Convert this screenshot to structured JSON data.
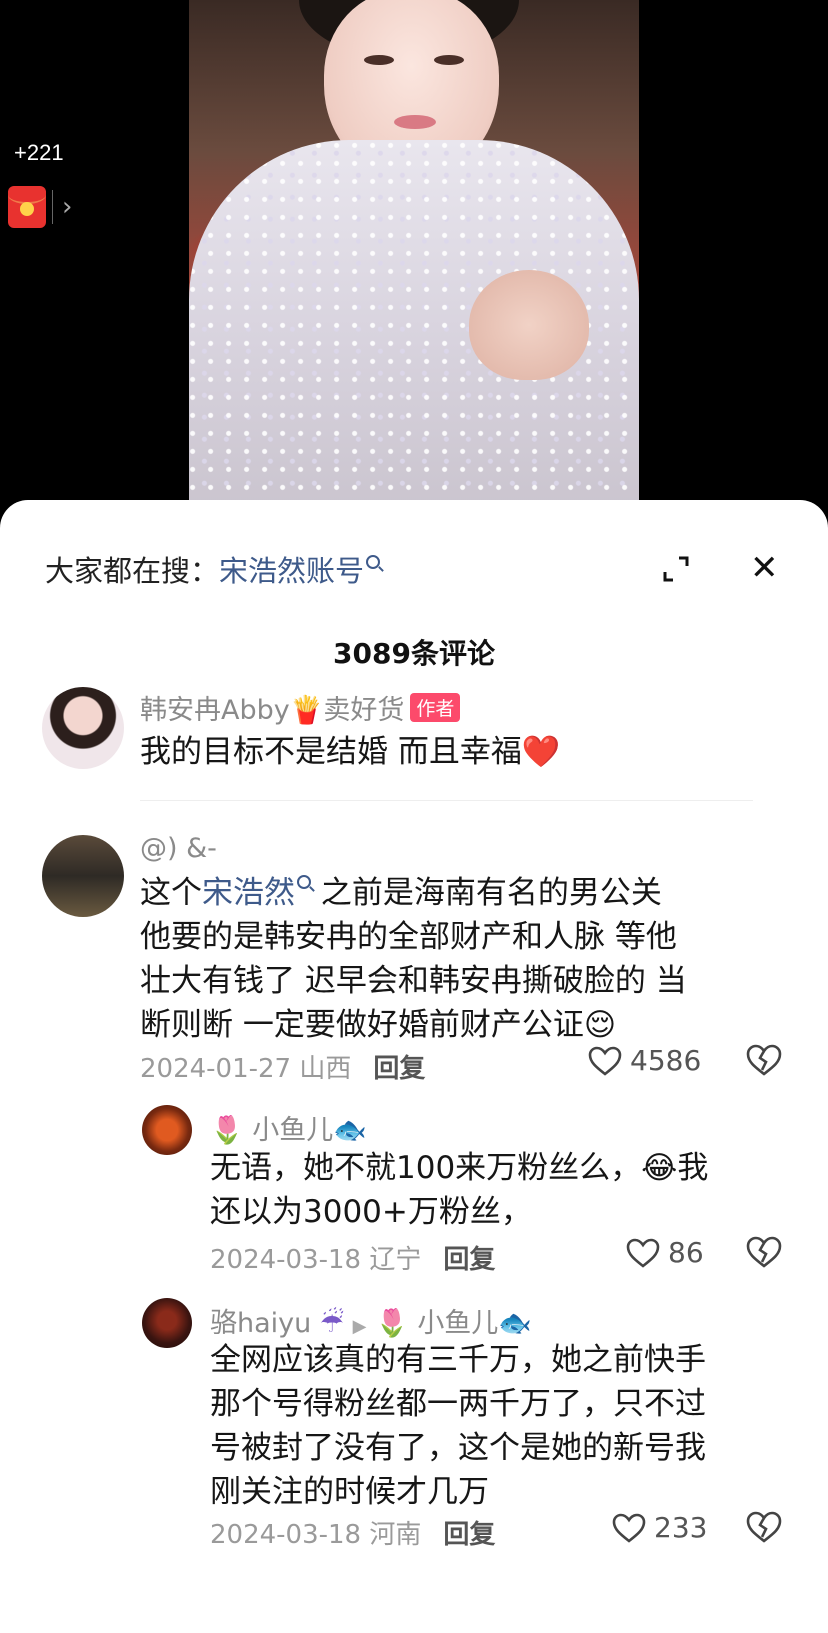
{
  "top": {
    "reward_count": "+221",
    "chevron": "›"
  },
  "sheet": {
    "search_label": "大家都在搜：",
    "search_term": "宋浩然账号",
    "close": "✕",
    "comment_count": "3089条评论"
  },
  "comments": [
    {
      "user": "韩安冉Abby",
      "user_suffix": "卖好货",
      "badge": "作者",
      "text": "我的目标不是结婚 而且幸福",
      "emoji": "❤️"
    },
    {
      "user": "@) &-",
      "text_prefix": "这个",
      "text_link": "宋浩然",
      "text_lines": [
        "之前是海南有名的男公关",
        "他要的是韩安冉的全部财产和人脉 等他",
        "壮大有钱了 迟早会和韩安冉撕破脸的 当",
        "断则断 一定要做好婚前财产公证"
      ],
      "emoji": "😌",
      "date": "2024-01-27",
      "location": "山西",
      "reply": "回复",
      "likes": "4586"
    },
    {
      "user_prefix_emoji": "🌷",
      "user": "小鱼儿",
      "user_suffix_emoji": "🐟",
      "text_line1": "无语，她不就100来万粉丝么，",
      "emoji": "😂",
      "text_line1_end": "我",
      "text_line2": "还以为3000+万粉丝，",
      "date": "2024-03-18",
      "location": "辽宁",
      "reply": "回复",
      "likes": "86"
    },
    {
      "user": "骆haiyu",
      "user_emoji": "☔",
      "arrow": "▶",
      "reply_to_emoji": "🌷",
      "reply_to": "小鱼儿",
      "reply_to_suffix_emoji": "🐟",
      "text_lines": [
        "全网应该真的有三千万，她之前快手",
        "那个号得粉丝都一两千万了，只不过",
        "号被封了没有了，这个是她的新号我",
        "刚关注的时候才几万"
      ],
      "date": "2024-03-18",
      "location": "河南",
      "reply": "回复",
      "likes": "233"
    }
  ],
  "colors": {
    "link": "#3e5a8a",
    "badge": "#fc4a6b",
    "meta": "#9a9a9a",
    "envelope": "#e8322f"
  },
  "icons": [
    "red-envelope-icon",
    "chevron-right-icon",
    "search-icon",
    "collapse-icon",
    "close-icon",
    "heart-icon",
    "dislike-icon"
  ]
}
